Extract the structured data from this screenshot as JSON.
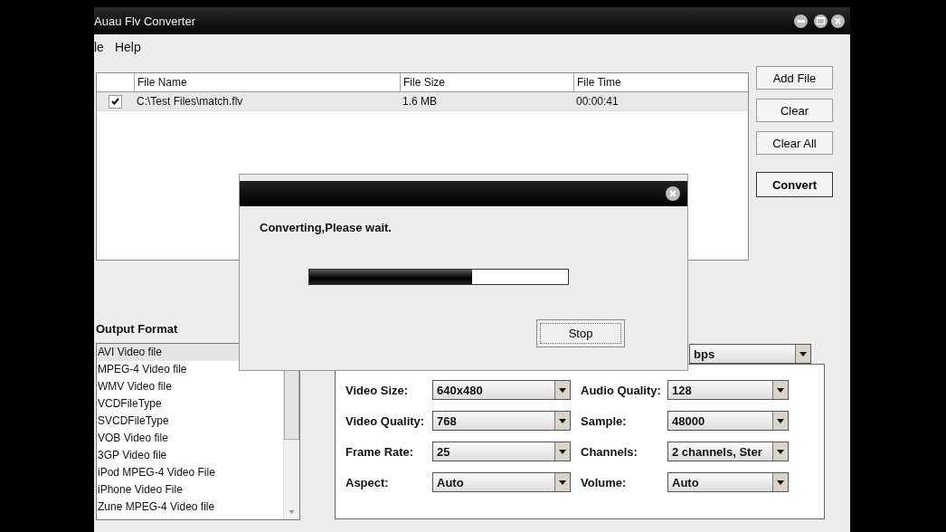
{
  "window": {
    "title": "Auau Flv Converter"
  },
  "menu": [
    "le",
    "Help"
  ],
  "table": {
    "columns": [
      "File Name",
      "File Size",
      "File Time"
    ],
    "rows": [
      {
        "checked": true,
        "cells": [
          "C:\\Test Files\\match.flv",
          "1.6 MB",
          "00:00:41"
        ]
      }
    ]
  },
  "buttons": [
    {
      "label": "Add File",
      "default": false
    },
    {
      "label": "Clear",
      "default": false
    },
    {
      "label": "Clear All",
      "default": false
    },
    {
      "label": "Convert",
      "default": true
    }
  ],
  "output_format": {
    "label": "Output Format",
    "items": [
      {
        "label": "AVI Video file",
        "selected": true
      },
      {
        "label": "MPEG-4 Video file",
        "selected": false
      },
      {
        "label": "WMV Video file",
        "selected": false
      },
      {
        "label": "VCDFileType",
        "selected": false
      },
      {
        "label": "SVCDFileType",
        "selected": false
      },
      {
        "label": "VOB Video file",
        "selected": false
      },
      {
        "label": "3GP Video file",
        "selected": false
      },
      {
        "label": "iPod MPEG-4 Video File",
        "selected": false
      },
      {
        "label": "iPhone Video File",
        "selected": false
      },
      {
        "label": "Zune MPEG-4 Video file",
        "selected": false
      }
    ]
  },
  "top_combo": {
    "value": "bps"
  },
  "settings": [
    {
      "label": "Video Size:",
      "value": "640x480"
    },
    {
      "label": "Audio Quality:",
      "value": "128"
    },
    {
      "label": "Video Quality:",
      "value": "768"
    },
    {
      "label": "Sample:",
      "value": "48000"
    },
    {
      "label": "Frame Rate:",
      "value": "25"
    },
    {
      "label": "Channels:",
      "value": "2 channels, Ster"
    },
    {
      "label": "Aspect:",
      "value": "Auto"
    },
    {
      "label": "Volume:",
      "value": "Auto"
    }
  ],
  "dialog": {
    "message": "Converting,Please wait.",
    "progress": {
      "level": 0.63
    },
    "button": "Stop"
  }
}
